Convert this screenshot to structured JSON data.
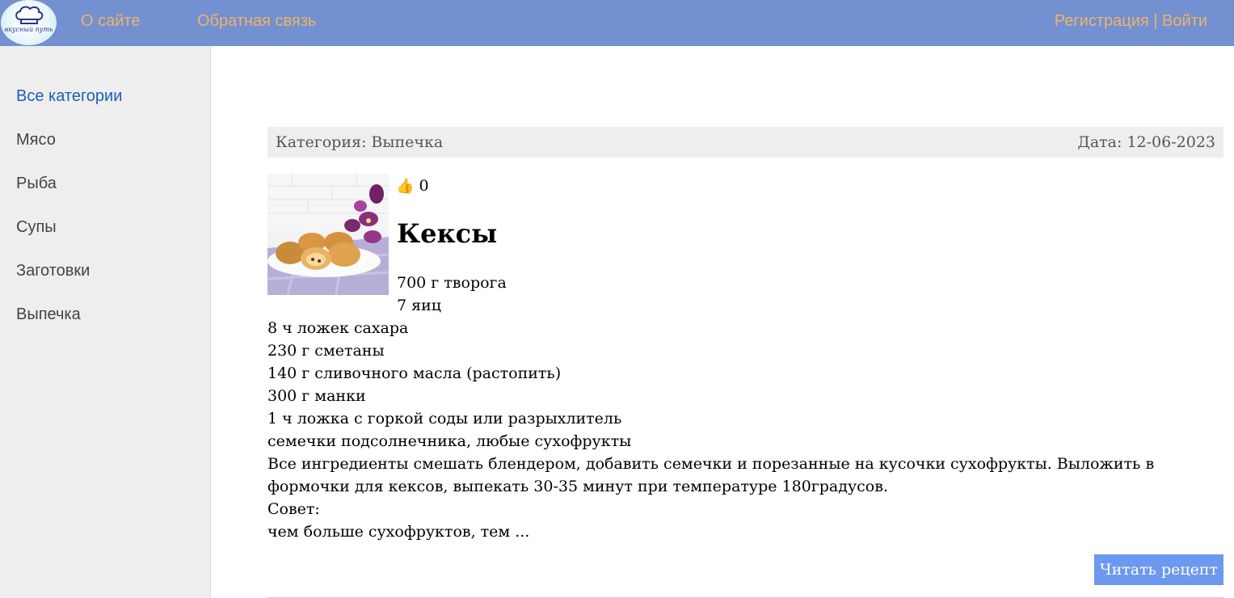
{
  "header": {
    "logo_text": "вкусный путь",
    "nav": [
      {
        "label": "О сайте"
      },
      {
        "label": "Обратная связь"
      }
    ],
    "auth": {
      "register_label": "Регистрация",
      "separator": " | ",
      "login_label": "Войти"
    },
    "colors": {
      "bar": "#7390d0",
      "link": "#f0b36a"
    }
  },
  "sidebar": {
    "items": [
      {
        "label": "Все категории",
        "active": true
      },
      {
        "label": "Мясо"
      },
      {
        "label": "Рыба"
      },
      {
        "label": "Супы"
      },
      {
        "label": "Заготовки"
      },
      {
        "label": "Выпечка"
      }
    ]
  },
  "post": {
    "category": "Категория: Выпечка",
    "date": "Дата: 12-06-2023",
    "likes_icon": "👍",
    "likes_count": "0",
    "title": "Кексы",
    "ingredients": [
      "700 г творога",
      "7 яиц",
      "8 ч ложек сахара",
      "230 г сметаны",
      "140 г сливочного масла (растопить)",
      "300 г манки",
      "1 ч ложка с горкой соды или разрыхлитель",
      "семечки подсолнечника, любые сухофрукты"
    ],
    "instructions": "Все ингредиенты смешать блендером, добавить семечки и порезанные на кусочки сухофрукты. Выложить в формочки для кексов, выпекать 30-35 минут при температуре 180градусов.",
    "tip_label": "Совет:",
    "tip_text": "чем больше сухофруктов, тем ...",
    "read_button": "Читать рецепт",
    "button_color": "#6d98ef"
  }
}
